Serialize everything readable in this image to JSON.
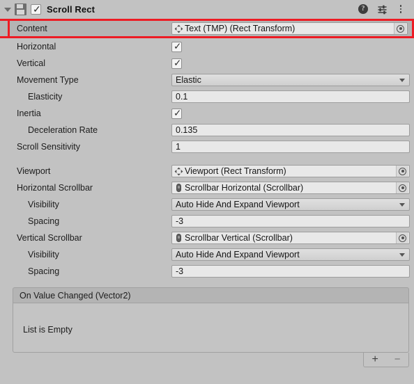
{
  "component": {
    "title": "Scroll Rect",
    "enabled": true,
    "expanded": true,
    "icons": {
      "foldout": "foldout-triangle-icon",
      "component": "scroll-rect-component-icon",
      "help": "?",
      "preset": "preset-sliders-icon",
      "menu": "kebab-menu-icon"
    }
  },
  "properties": {
    "content": {
      "label": "Content",
      "value": "Text (TMP) (Rect Transform)",
      "icon": "rect-transform-icon",
      "highlighted": true
    },
    "horizontal": {
      "label": "Horizontal",
      "checked": true
    },
    "vertical": {
      "label": "Vertical",
      "checked": true
    },
    "movement_type": {
      "label": "Movement Type",
      "value": "Elastic"
    },
    "elasticity": {
      "label": "Elasticity",
      "value": "0.1"
    },
    "inertia": {
      "label": "Inertia",
      "checked": true
    },
    "deceleration_rate": {
      "label": "Deceleration Rate",
      "value": "0.135"
    },
    "scroll_sensitivity": {
      "label": "Scroll Sensitivity",
      "value": "1"
    },
    "viewport": {
      "label": "Viewport",
      "value": "Viewport (Rect Transform)",
      "icon": "rect-transform-icon"
    },
    "horizontal_scrollbar": {
      "label": "Horizontal Scrollbar",
      "value": "Scrollbar Horizontal (Scrollbar)",
      "icon": "scrollbar-icon"
    },
    "horizontal_visibility": {
      "label": "Visibility",
      "value": "Auto Hide And Expand Viewport"
    },
    "horizontal_spacing": {
      "label": "Spacing",
      "value": "-3"
    },
    "vertical_scrollbar": {
      "label": "Vertical Scrollbar",
      "value": "Scrollbar Vertical (Scrollbar)",
      "icon": "scrollbar-icon"
    },
    "vertical_visibility": {
      "label": "Visibility",
      "value": "Auto Hide And Expand Viewport"
    },
    "vertical_spacing": {
      "label": "Spacing",
      "value": "-3"
    }
  },
  "event": {
    "header": "On Value Changed (Vector2)",
    "empty_text": "List is Empty",
    "add_label": "+",
    "remove_label": "−"
  },
  "colors": {
    "background": "#c2c2c2",
    "highlight_border": "#ed1c24",
    "highlight_row": "#b4b4b4",
    "field_background": "#e8e8e8",
    "text": "#1c1c1c"
  }
}
